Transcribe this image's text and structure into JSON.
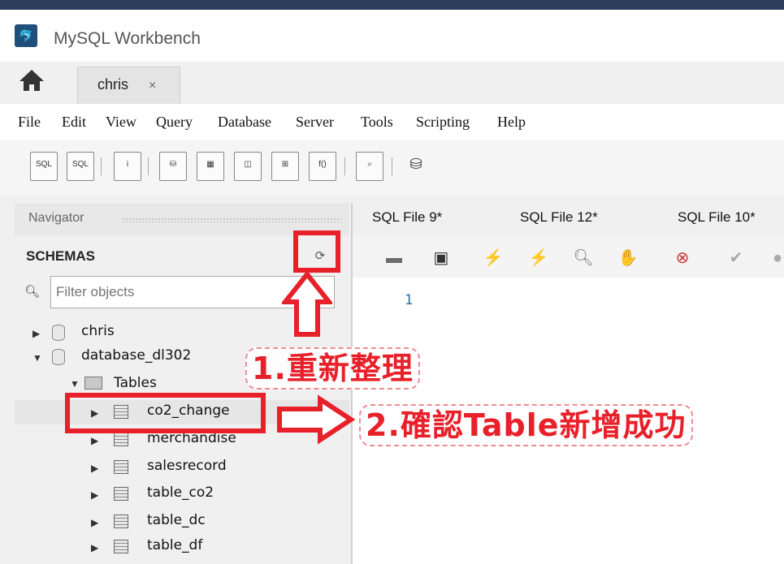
{
  "window": {
    "title": "MySQL Workbench"
  },
  "connection_tab": {
    "label": "chris",
    "close": "×"
  },
  "menu": [
    "File",
    "Edit",
    "View",
    "Query",
    "Database",
    "Server",
    "Tools",
    "Scripting",
    "Help"
  ],
  "toolbar_icons": [
    "new-sql-tab-icon",
    "open-sql-script-icon",
    "inspector-icon",
    "create-schema-icon",
    "create-table-icon",
    "create-view-icon",
    "create-procedure-icon",
    "create-function-icon",
    "search-table-data-icon",
    "reconnect-icon"
  ],
  "navigator": {
    "header": "Navigator",
    "schemas_label": "SCHEMAS",
    "filter_placeholder": "Filter objects",
    "tree": {
      "schema_1": "chris",
      "schema_2": "database_dl302",
      "tables_folder": "Tables",
      "tables": [
        "co2_change",
        "merchandise",
        "salesrecord",
        "table_co2",
        "table_dc",
        "table_df"
      ]
    }
  },
  "sql_tabs": [
    "SQL File 9*",
    "SQL File 12*",
    "SQL File 10*"
  ],
  "editor": {
    "line_number": "1"
  },
  "annotations": {
    "step1": "1.重新整理",
    "step2": "2.確認Table新增成功"
  },
  "colors": {
    "highlight_red": "#e8202a",
    "title_bar_dark": "#2b3d5a"
  }
}
